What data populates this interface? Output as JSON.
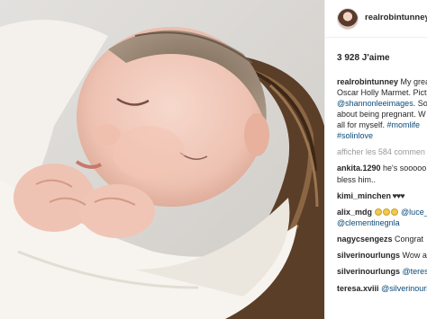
{
  "post": {
    "username": "realrobintunney",
    "likes": "3 928 J'aime",
    "caption_lines": [
      {
        "user": "realrobintunney",
        "text": " My grea"
      },
      {
        "text": "Oscar Holly Marmet. Pict"
      },
      {
        "link": "@shannonleeimages",
        "text": ". So"
      },
      {
        "text": "about being pregnant. W"
      },
      {
        "text": "all for myself. ",
        "link": "#momlife"
      },
      {
        "link": "#solinlove"
      }
    ],
    "view_comments": "afficher les 584 commen"
  },
  "comments": [
    {
      "user": "ankita.1290",
      "text": " he's sooooo",
      "cont": "bless him.."
    },
    {
      "user": "kimi_minchen",
      "text": " ♥♥♥"
    },
    {
      "user": "alix_mdg",
      "text": "",
      "link": "@luce_",
      "cont_link": "@clementinegnla"
    },
    {
      "user": "nagycsengezs",
      "text": " Congrat"
    },
    {
      "user": "silverinourlungs",
      "text": " Wow amazing"
    },
    {
      "user": "silverinourlungs",
      "link": "@teresa"
    },
    {
      "user": "teresa.xviii",
      "link": "@silverinourl"
    }
  ],
  "colors": {
    "link": "#0a4a78",
    "muted": "#999999",
    "text": "#262626"
  }
}
